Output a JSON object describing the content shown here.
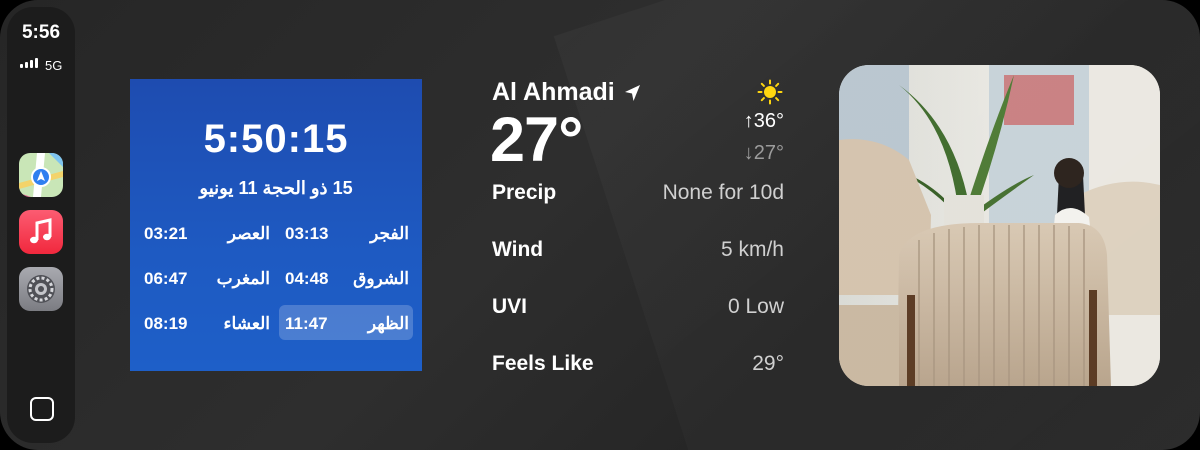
{
  "status": {
    "time": "5:56",
    "network": "5G"
  },
  "dock": {
    "apps": [
      {
        "name": "maps-app",
        "icon": "maps-icon"
      },
      {
        "name": "music-app",
        "icon": "music-icon"
      },
      {
        "name": "settings-app",
        "icon": "settings-icon"
      }
    ],
    "home_icon": "home-grid-icon"
  },
  "prayer": {
    "clock": "5:50:15",
    "date": "15 ذو الحجة 11 يونيو",
    "times": [
      {
        "name": "الفجر",
        "time": "03:13"
      },
      {
        "name": "العصر",
        "time": "03:21"
      },
      {
        "name": "الشروق",
        "time": "04:48"
      },
      {
        "name": "المغرب",
        "time": "06:47"
      },
      {
        "name": "الظهر",
        "time": "11:47"
      },
      {
        "name": "العشاء",
        "time": "08:19"
      }
    ],
    "colors": {
      "background": "#1e55bd"
    }
  },
  "weather": {
    "city": "Al Ahmadi",
    "location_icon": "location-arrow-icon",
    "condition_icon": "sun-icon",
    "temperature": "27°",
    "high": "↑36°",
    "low": "↓27°",
    "details": [
      {
        "label": "Precip",
        "value": "None for 10d"
      },
      {
        "label": "Wind",
        "value": "5 km/h"
      },
      {
        "label": "UVI",
        "value": "0 Low"
      },
      {
        "label": "Feels Like",
        "value": "29°"
      }
    ]
  },
  "photo": {
    "subject": "photo-widget"
  }
}
